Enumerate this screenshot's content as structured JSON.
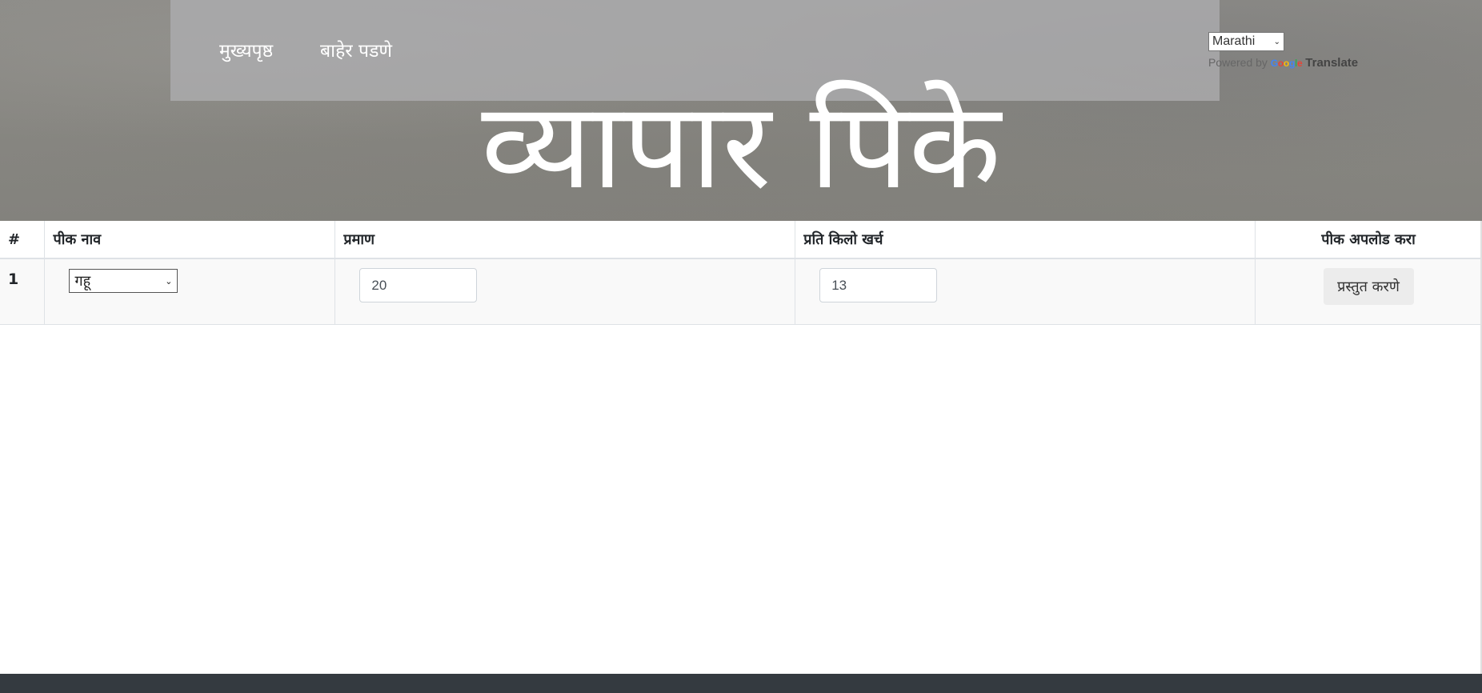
{
  "nav": {
    "home_label": "मुख्यपृष्ठ",
    "logout_label": "बाहेर पडणे"
  },
  "translate": {
    "language_selected": "Marathi",
    "powered_by": "Powered by",
    "google_letters": [
      "G",
      "o",
      "o",
      "g",
      "l",
      "e"
    ],
    "translate_label": "Translate"
  },
  "hero": {
    "title": "व्यापार पिके"
  },
  "table": {
    "headers": [
      "#",
      "पीक नाव",
      "प्रमाण",
      "प्रति किलो खर्च",
      "पीक अपलोड करा"
    ],
    "rows": [
      {
        "index": "1",
        "crop_selected": "गहू",
        "quantity": "20",
        "price_per_kg": "13",
        "submit_label": "प्रस्तुत करणे"
      }
    ]
  },
  "colors": {
    "hero_bg": "#888782",
    "navbar_bg": "#afafb1",
    "footer_bg": "#343a40",
    "row_bg": "#f9f9f9"
  }
}
